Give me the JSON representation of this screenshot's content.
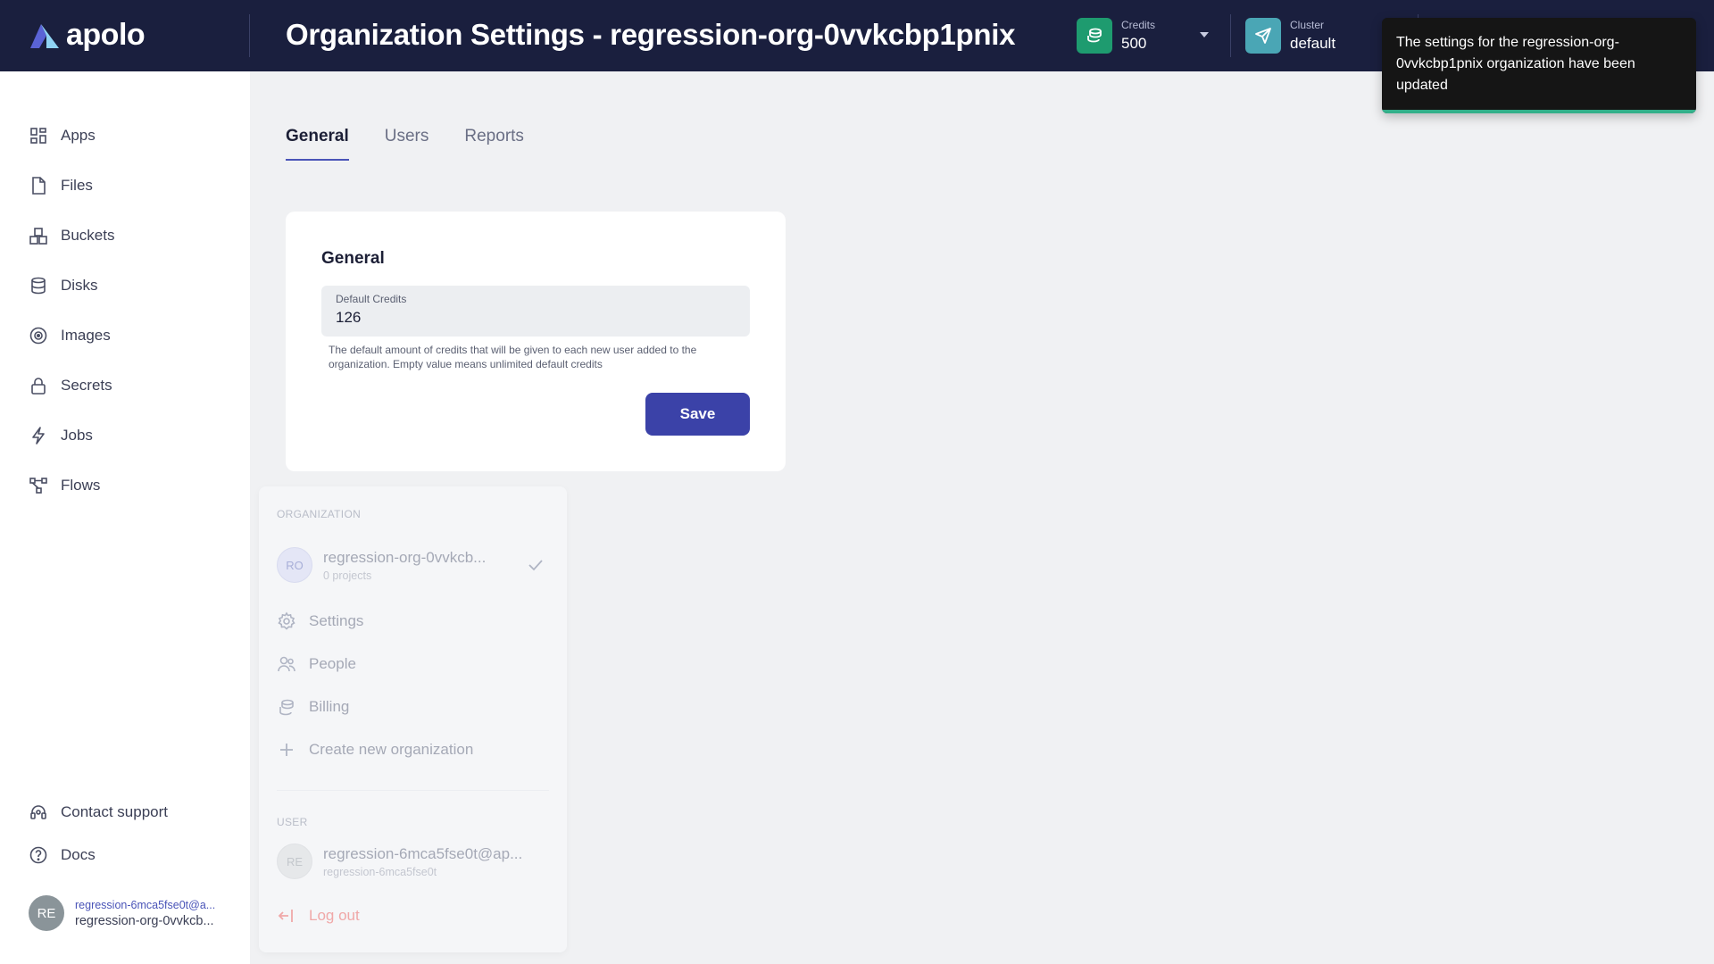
{
  "app": {
    "logo_text": "apolo"
  },
  "header": {
    "title": "Organization Settings - regression-org-0vvkcbp1pnix",
    "credits_label": "Credits",
    "credits_value": "500",
    "cluster_label": "Cluster",
    "cluster_value": "default"
  },
  "toast": {
    "message": "The settings for the regression-org-0vvkcbp1pnix organization have been updated"
  },
  "sidebar": {
    "items": [
      {
        "label": "Apps",
        "icon": "apps-icon"
      },
      {
        "label": "Files",
        "icon": "file-icon"
      },
      {
        "label": "Buckets",
        "icon": "buckets-icon"
      },
      {
        "label": "Disks",
        "icon": "database-icon"
      },
      {
        "label": "Images",
        "icon": "images-icon"
      },
      {
        "label": "Secrets",
        "icon": "lock-icon"
      },
      {
        "label": "Jobs",
        "icon": "lightning-icon"
      },
      {
        "label": "Flows",
        "icon": "flows-icon"
      }
    ],
    "footer_items": [
      {
        "label": "Contact support",
        "icon": "headset-icon"
      },
      {
        "label": "Docs",
        "icon": "help-circle-icon"
      }
    ],
    "user": {
      "initials": "RE",
      "email": "regression-6mca5fse0t@a...",
      "org": "regression-org-0vvkcb..."
    }
  },
  "tabs": [
    {
      "label": "General",
      "active": true
    },
    {
      "label": "Users",
      "active": false
    },
    {
      "label": "Reports",
      "active": false
    }
  ],
  "general_card": {
    "title": "General",
    "field_label": "Default Credits",
    "field_value": "126",
    "help_text": "The default amount of credits that will be given to each new user added to the organization. Empty value means unlimited default credits",
    "save_label": "Save"
  },
  "org_menu": {
    "organization_heading": "ORGANIZATION",
    "org_initials": "RO",
    "org_name": "regression-org-0vvkcb...",
    "org_projects": "0 projects",
    "items": [
      {
        "label": "Settings",
        "icon": "gear-icon"
      },
      {
        "label": "People",
        "icon": "people-icon"
      },
      {
        "label": "Billing",
        "icon": "billing-icon"
      },
      {
        "label": "Create new organization",
        "icon": "plus-icon"
      }
    ],
    "user_heading": "USER",
    "user_initials": "RE",
    "user_email": "regression-6mca5fse0t@ap...",
    "user_name": "regression-6mca5fse0t",
    "logout_label": "Log out"
  },
  "colors": {
    "header_bg": "#1a1f3e",
    "accent": "#3b42a8",
    "credits_icon_bg": "#1e9b6f",
    "cluster_icon_bg": "#4aa6b5",
    "toast_bar": "#33b08a"
  }
}
